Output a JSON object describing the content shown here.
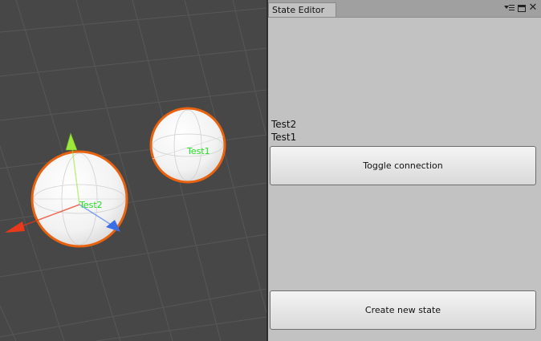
{
  "scene": {
    "objects": [
      {
        "label": "Test2"
      },
      {
        "label": "Test1"
      }
    ]
  },
  "editor": {
    "tab_title": "State Editor",
    "window_controls": [
      "menu-icon",
      "maximize-icon",
      "close-icon"
    ],
    "close_glyph": "✕",
    "states": [
      "Test2",
      "Test1"
    ],
    "toggle_button_label": "Toggle connection",
    "create_button_label": "Create new state"
  },
  "colors": {
    "scene_background": "#474747",
    "grid_line": "#5a5a5a",
    "sphere_outline": "#e8620f",
    "label_green": "#22e022",
    "axis_x": "#e83a1a",
    "axis_y": "#9ee83a",
    "axis_z": "#3a6ee8",
    "panel_background": "#c2c2c2"
  }
}
